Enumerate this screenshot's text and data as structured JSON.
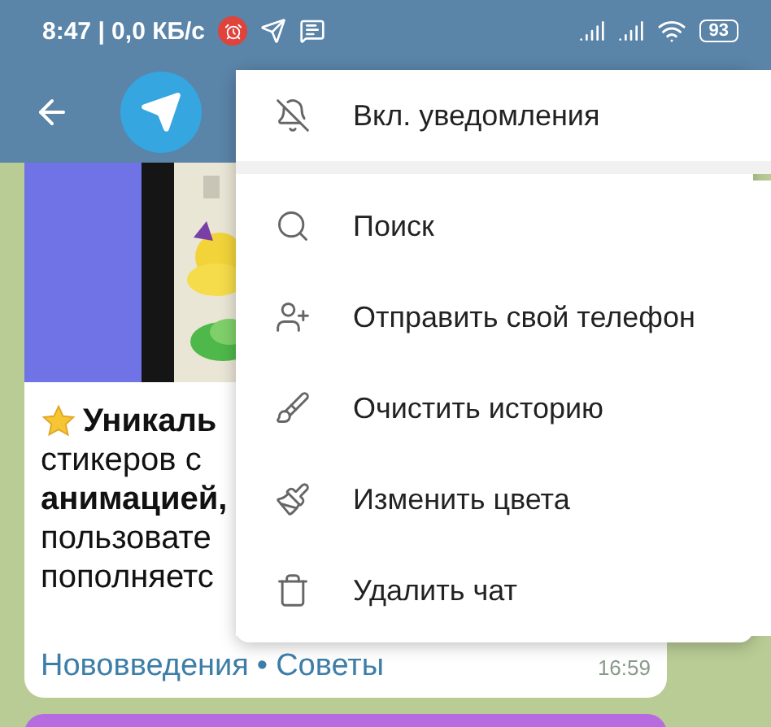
{
  "status_bar": {
    "time_and_speed": "8:47 | 0,0 КБ/с",
    "battery": "93"
  },
  "message": {
    "lines": [
      {
        "text": "Уникаль",
        "bold": true,
        "star": true
      },
      {
        "text": "стикеров с",
        "bold": false,
        "star": false
      },
      {
        "text": "анимацией,",
        "bold": true,
        "star": false
      },
      {
        "text": "пользовате",
        "bold": false,
        "star": false
      },
      {
        "text": "пополняетс",
        "bold": false,
        "star": false
      }
    ],
    "tags": [
      "Нововведения",
      "Советы"
    ],
    "tag_separator": "•",
    "time": "16:59"
  },
  "menu": {
    "items": [
      {
        "label": "Вкл. уведомления",
        "kind": "unmute",
        "divider_after": true
      },
      {
        "label": "Поиск",
        "kind": "search",
        "divider_after": false
      },
      {
        "label": "Отправить свой телефон",
        "kind": "share-phone",
        "divider_after": false
      },
      {
        "label": "Очистить историю",
        "kind": "clear",
        "divider_after": false
      },
      {
        "label": "Изменить цвета",
        "kind": "colors",
        "divider_after": false
      },
      {
        "label": "Удалить чат",
        "kind": "delete",
        "divider_after": false
      }
    ]
  }
}
